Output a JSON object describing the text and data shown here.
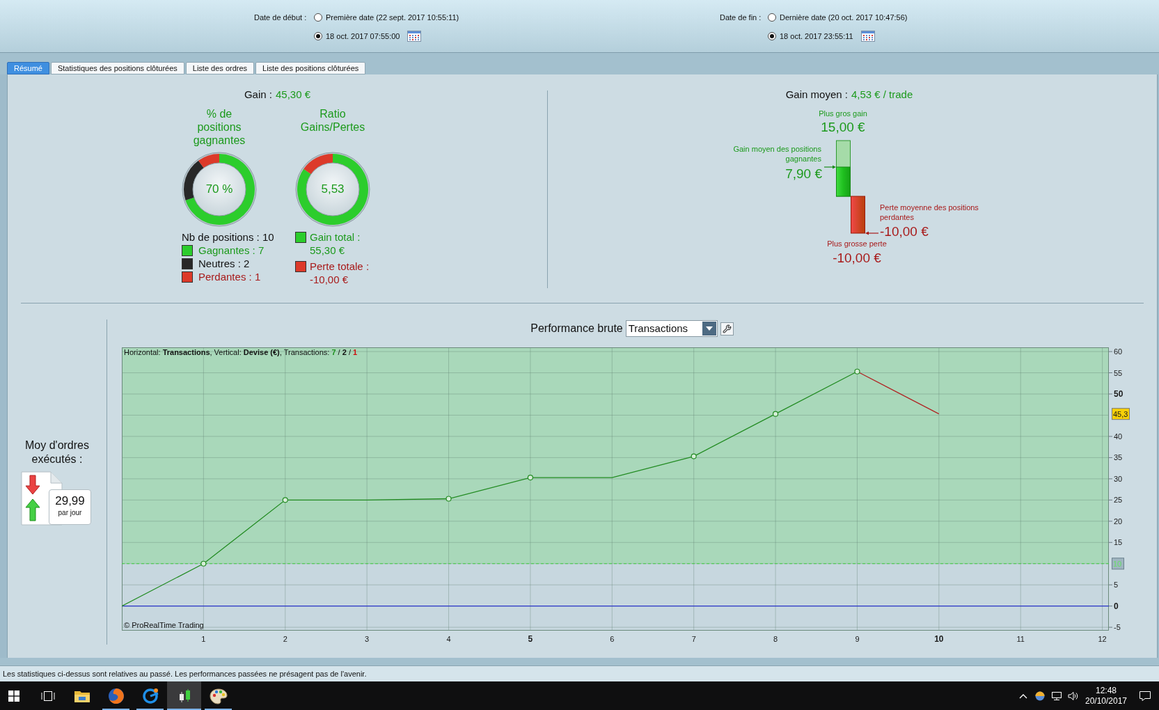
{
  "header": {
    "date_ranges": [
      {
        "label": "Date de début :",
        "options": [
          {
            "text": "Première date (22 sept. 2017 10:55:11)",
            "kind": "preset",
            "selected": false
          },
          {
            "text": "18 oct. 2017 07:55:00",
            "kind": "custom",
            "selected": true
          }
        ]
      },
      {
        "label": "Date de fin :",
        "options": [
          {
            "text": "Dernière date (20 oct. 2017 10:47:56)",
            "kind": "preset",
            "selected": false
          },
          {
            "text": "18 oct. 2017 23:55:11",
            "kind": "custom",
            "selected": true
          }
        ]
      }
    ]
  },
  "tabs": [
    {
      "label": "Résumé",
      "selected": true
    },
    {
      "label": "Statistiques des positions clôturées",
      "selected": false
    },
    {
      "label": "Liste des ordres",
      "selected": false
    },
    {
      "label": "Liste des positions clôturées",
      "selected": false
    }
  ],
  "summary": {
    "gain": {
      "label": "Gain :",
      "value": "45,30 €"
    },
    "win_rate": {
      "title": "% de positions gagnantes",
      "center": "70 %",
      "chart_data": {
        "type": "donut",
        "values": [
          70,
          20,
          10
        ]
      },
      "total": "Nb de positions : 10",
      "legend": [
        {
          "text": "Gagnantes : 7",
          "kind": "win",
          "color": "#2ccd2c"
        },
        {
          "text": "Neutres : 2",
          "kind": "neutral",
          "color": "#282828"
        },
        {
          "text": "Perdantes : 1",
          "kind": "loss",
          "color": "#dc3a2a"
        }
      ]
    },
    "ratio": {
      "title": "Ratio Gains/Pertes",
      "center": "5,53",
      "chart_data": {
        "type": "donut",
        "values": [
          84.7,
          15.3
        ]
      },
      "legend": [
        {
          "label": "Gain total :",
          "value": "55,30 €",
          "kind": "win",
          "color": "#2ccd2c"
        },
        {
          "label": "Perte totale :",
          "value": "-10,00 €",
          "kind": "loss",
          "color": "#dc3a2a"
        }
      ]
    },
    "average": {
      "label": "Gain moyen :",
      "value": "4,53 € / trade"
    },
    "extremes": {
      "labels": [
        {
          "kind": "max_gain",
          "caption": "Plus gros gain",
          "value": "15,00 €"
        },
        {
          "kind": "avg_gain",
          "caption": "Gain moyen des positions gagnantes",
          "value": "7,90 €"
        },
        {
          "kind": "avg_loss",
          "caption": "Perte moyenne des positions perdantes",
          "value": "-10,00 €"
        },
        {
          "kind": "max_loss",
          "caption": "Plus grosse perte",
          "value": "-10,00 €"
        }
      ]
    }
  },
  "orders": {
    "title": "Moy d'ordres exécutés :",
    "value": "29,99",
    "unit": "par jour"
  },
  "performance": {
    "title": "Performance brute",
    "dropdown": {
      "value": "Transactions"
    },
    "legend": {
      "text": "Horizontal: **Transactions**, Vertical: **Devise (€)**, Transactions:",
      "parts": [
        {
          "text": "7",
          "kind": "count",
          "color": "#1c8f1c"
        },
        {
          "text": "/",
          "kind": "separator"
        },
        {
          "text": "2",
          "kind": "count",
          "color": "#111111"
        },
        {
          "text": "/",
          "kind": "separator"
        },
        {
          "text": "1",
          "kind": "count",
          "color": "#cc1111"
        }
      ]
    },
    "credit": "© ProRealTime Trading",
    "chart_data": {
      "type": "line",
      "x": [
        0,
        1,
        2,
        3,
        4,
        5,
        6,
        7,
        8,
        9,
        10
      ],
      "series": [
        {
          "color": "#238c23",
          "values": [
            0,
            10,
            25,
            25,
            25.3,
            30.3,
            30.3,
            35.3,
            45.3,
            55.3,
            null
          ]
        },
        {
          "color": "#b02222",
          "values": [
            null,
            null,
            null,
            null,
            null,
            null,
            null,
            null,
            null,
            55.3,
            45.3
          ]
        }
      ],
      "xlim": [
        0,
        12.08
      ],
      "ylim": [
        -5.8,
        61
      ],
      "xticks": [
        1,
        2,
        3,
        4,
        5,
        6,
        7,
        8,
        9,
        10,
        11,
        12
      ],
      "yticks": [
        -5,
        0,
        5,
        15,
        20,
        25,
        30,
        35,
        40,
        50,
        55,
        60
      ],
      "grid": true,
      "bands": [
        {
          "axis": "y",
          "from": 10,
          "to": 61,
          "color": "#a9d8ba"
        }
      ],
      "ref_lines": [
        {
          "axis": "y",
          "value": 10,
          "label": "10",
          "color": "#3fcf3f"
        },
        {
          "axis": "y",
          "value": 0,
          "color": "#2a34c8"
        }
      ],
      "annotations": [
        "45,3"
      ]
    }
  },
  "status_bar": {
    "text": "Les statistiques ci-dessus sont relatives au passé. Les performances passées ne présagent pas de l'avenir."
  },
  "taskbar": {
    "apps": [
      {
        "running": false,
        "selected": false
      },
      {
        "running": true,
        "selected": false
      },
      {
        "running": true,
        "selected": false
      },
      {
        "running": true,
        "selected": true
      },
      {
        "running": true,
        "selected": false
      }
    ],
    "clock": {
      "time": "12:48",
      "date": "20/10/2017"
    }
  }
}
